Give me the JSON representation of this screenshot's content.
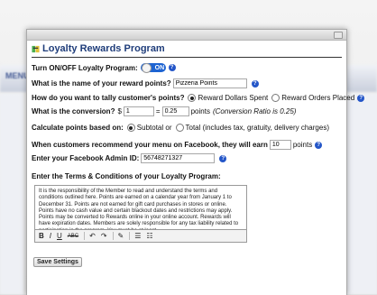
{
  "background": {
    "logo_text": "MENU"
  },
  "window": {
    "title": "Loyalty Rewards Program",
    "toggle": {
      "label": "Turn ON/OFF Loyalty Program:",
      "state": "ON"
    },
    "reward_name": {
      "label": "What is the name of your reward points?",
      "value": "Pizzeria Points"
    },
    "tally": {
      "label": "How do you want to tally customer's points?",
      "options": [
        "Reward Dollars Spent",
        "Reward Orders Placed"
      ],
      "selected": "Reward Dollars Spent"
    },
    "conversion": {
      "label": "What is the conversion?",
      "currency": "$",
      "dollars": "1",
      "equals": "=",
      "points": "0.25",
      "points_label": "points",
      "note": "(Conversion Ratio is 0.25)"
    },
    "calc": {
      "label": "Calculate points based on:",
      "options": [
        "Subtotal or",
        "Total (includes tax, gratuity, delivery charges)"
      ],
      "selected": "Subtotal or"
    },
    "facebook_points": {
      "label": "When customers recommend your menu on Facebook, they will earn",
      "value": "10",
      "suffix": "points"
    },
    "facebook_admin": {
      "label": "Enter your Facebook Admin ID:",
      "value": "56748271327"
    },
    "terms": {
      "label": "Enter the Terms & Conditions of your Loyalty Program:",
      "text": "It is the responsibility of the Member to read and understand the terms and conditions outlined here. Points are earned on a calendar year from January 1 to December 31. Points are not earned for gift card purchases in stores or online. Points have no cash value and certain blackout dates and restrictions may apply. Points may be converted to Rewards online in your online account. Rewards will have expiration dates. Members are solely responsible for any tax liability related to participation in the program. You must be at least"
    },
    "save_label": "Save Settings"
  }
}
